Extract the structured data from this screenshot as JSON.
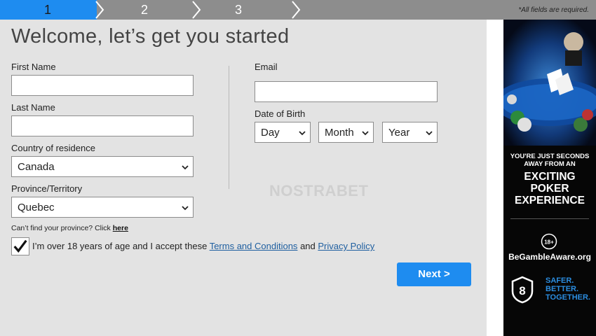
{
  "progress": {
    "steps": [
      "1",
      "2",
      "3"
    ],
    "active_step": "1",
    "required_note": "*All fields are required."
  },
  "form": {
    "title": "Welcome, let’s get you started",
    "first_name": {
      "label": "First Name",
      "value": ""
    },
    "last_name": {
      "label": "Last Name",
      "value": ""
    },
    "country": {
      "label": "Country of residence",
      "value": "Canada"
    },
    "province": {
      "label": "Province/Territory",
      "value": "Quebec"
    },
    "province_help": {
      "text": "Can’t find your province? Click",
      "link": "here"
    },
    "email": {
      "label": "Email",
      "value": ""
    },
    "dob": {
      "label": "Date of Birth",
      "day": "Day",
      "month": "Month",
      "year": "Year"
    },
    "agreement": {
      "checked": true,
      "text": "I’m over 18 years of age and I accept these",
      "terms": "Terms and Conditions",
      "and": "and",
      "privacy": "Privacy Policy"
    },
    "next_label": "Next >"
  },
  "watermark": "NOSTRABET",
  "ad": {
    "pre_line1": "YOU'RE JUST SECONDS",
    "pre_line2": "AWAY FROM AN",
    "headline1": "EXCITING",
    "headline2": "POKER",
    "headline3": "EXPERIENCE",
    "age_badge": "18+",
    "gamble_aware": "BeGambleAware.org",
    "safer1": "SAFER.",
    "safer2": "BETTER.",
    "safer3": "TOGETHER.",
    "shield_number": "8"
  },
  "colors": {
    "accent": "#1e8cf0",
    "progress_bg": "#8d8d8d",
    "page_bg": "#e3e3e3",
    "ad_bg": "#060606"
  }
}
